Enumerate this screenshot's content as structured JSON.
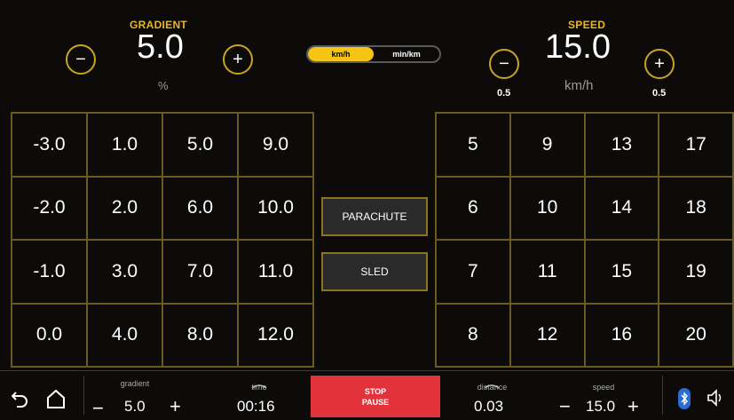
{
  "gradient": {
    "label": "GRADIENT",
    "value": "5.0",
    "unit": "%",
    "minus": "−",
    "plus": "+"
  },
  "speed": {
    "label": "SPEED",
    "value": "15.0",
    "unit": "km/h",
    "minus": "−",
    "plus": "+",
    "step_left": "0.5",
    "step_right": "0.5"
  },
  "unit_toggle": {
    "selected": "km/h",
    "other": "min/km"
  },
  "gradient_grid": [
    [
      "-3.0",
      "1.0",
      "5.0",
      "9.0"
    ],
    [
      "-2.0",
      "2.0",
      "6.0",
      "10.0"
    ],
    [
      "-1.0",
      "3.0",
      "7.0",
      "11.0"
    ],
    [
      "0.0",
      "4.0",
      "8.0",
      "12.0"
    ]
  ],
  "speed_grid": [
    [
      "5",
      "9",
      "13",
      "17"
    ],
    [
      "6",
      "10",
      "14",
      "18"
    ],
    [
      "7",
      "11",
      "15",
      "19"
    ],
    [
      "8",
      "12",
      "16",
      "20"
    ]
  ],
  "modes": {
    "parachute": "PARACHUTE",
    "sled": "SLED"
  },
  "bottom_bar": {
    "gradient_label": "gradient",
    "gradient_value": "5.0",
    "gradient_minus": "−",
    "gradient_plus": "+",
    "time_label": "time",
    "time_value": "00:16",
    "stop_line1": "STOP",
    "stop_line2": "PAUSE",
    "distance_label": "distance",
    "distance_value": "0.03",
    "speed_label": "speed",
    "speed_value": "15.0",
    "speed_minus": "−",
    "speed_plus": "+"
  },
  "colors": {
    "accent": "#e8b724",
    "grid_border": "#6b5a1e",
    "stop": "#e2323a",
    "background": "#0c0b09"
  },
  "icons": [
    "back-icon",
    "home-icon",
    "bluetooth-icon",
    "speaker-icon"
  ]
}
